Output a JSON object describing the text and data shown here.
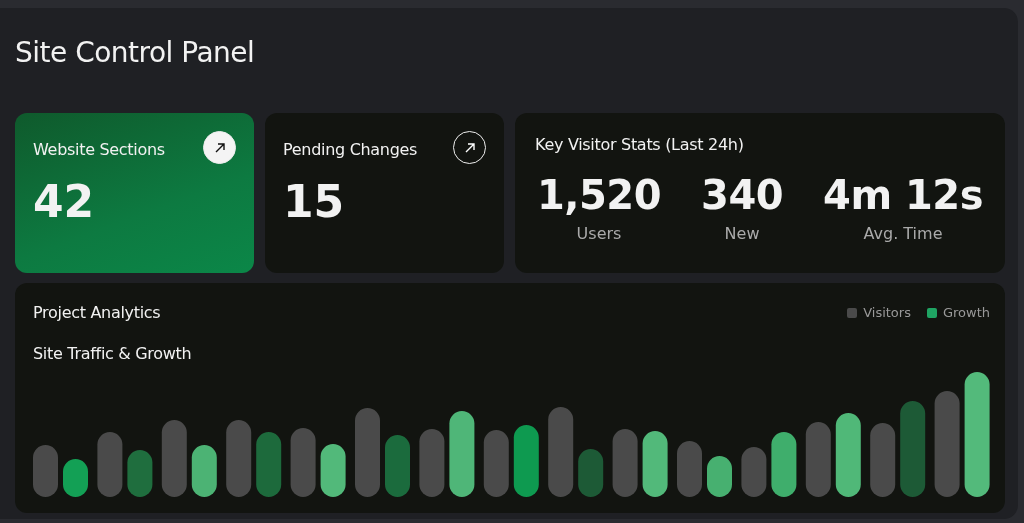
{
  "title": "Site Control Panel",
  "cards": [
    {
      "label": "Website Sections",
      "value": "42",
      "highlighted": true
    },
    {
      "label": "Pending Changes",
      "value": "15",
      "highlighted": false
    }
  ],
  "visitor_stats": {
    "title": "Key Visitor Stats (Last 24h)",
    "stats": [
      {
        "value": "1,520",
        "label": "Users"
      },
      {
        "value": "340",
        "label": "New"
      },
      {
        "value": "4m 12s",
        "label": "Avg. Time"
      }
    ]
  },
  "analytics": {
    "title": "Project Analytics",
    "subtitle": "Site Traffic & Growth",
    "legend": [
      {
        "label": "Visitors",
        "color": "#4a4a4a"
      },
      {
        "label": "Growth",
        "color": "#1fa463"
      }
    ],
    "kind": "picture"
  }
}
